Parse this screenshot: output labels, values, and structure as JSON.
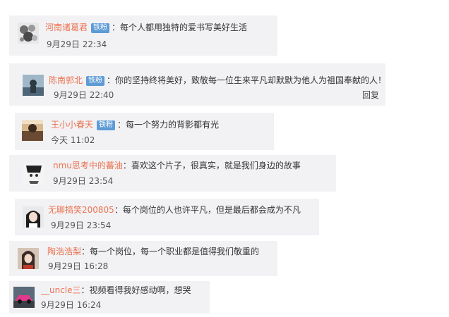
{
  "comments": [
    {
      "username": "河南诸葛君",
      "badge": "铁粉",
      "colon": "：",
      "text": "每个人都用独特的爱书写美好生活",
      "time": "9月29日 22:34",
      "avatar_icon": "avatar-floral-icon"
    },
    {
      "username": "陈南郭北",
      "badge": "铁粉",
      "colon": "：",
      "text": "你的坚持终将美好，致敬每一位生来平凡却默默为他人为祖国奉献的人！",
      "time": "9月29日 22:40",
      "reply": "回复",
      "avatar_icon": "avatar-silhouette-icon"
    },
    {
      "username": "王小小春天",
      "badge": "铁粉",
      "colon": "：",
      "text": "每一个努力的背影都有光",
      "time": "今天 11:02",
      "avatar_icon": "avatar-photo-icon"
    },
    {
      "username": "nmu思考中的蕃油",
      "colon": "：",
      "text": "喜欢这个片子，很真实，就是我们身边的故事",
      "time": "9月29日 23:54",
      "avatar_icon": "avatar-manga-icon"
    },
    {
      "username": "无聊搞笑200805",
      "colon": "：",
      "text": "每个岗位的人也许平凡，但是最后都会成为不凡",
      "time": "9月29日 23:54",
      "avatar_icon": "avatar-girl-icon"
    },
    {
      "username": "陶浩浩梨",
      "colon": "：",
      "text": "每一个岗位，每一个职业都是值得我们敬重的",
      "time": "9月29日 16:28",
      "avatar_icon": "avatar-portrait-icon"
    },
    {
      "username": "__uncle三",
      "colon": "：",
      "text": "视频看得我好感动啊，想哭",
      "time": "9月29日 16:24",
      "avatar_icon": "avatar-car-icon"
    }
  ],
  "colors": {
    "username": "#eb7350",
    "badge_bg": "#5d9bd5",
    "card_bg": "#f2f2f5"
  }
}
